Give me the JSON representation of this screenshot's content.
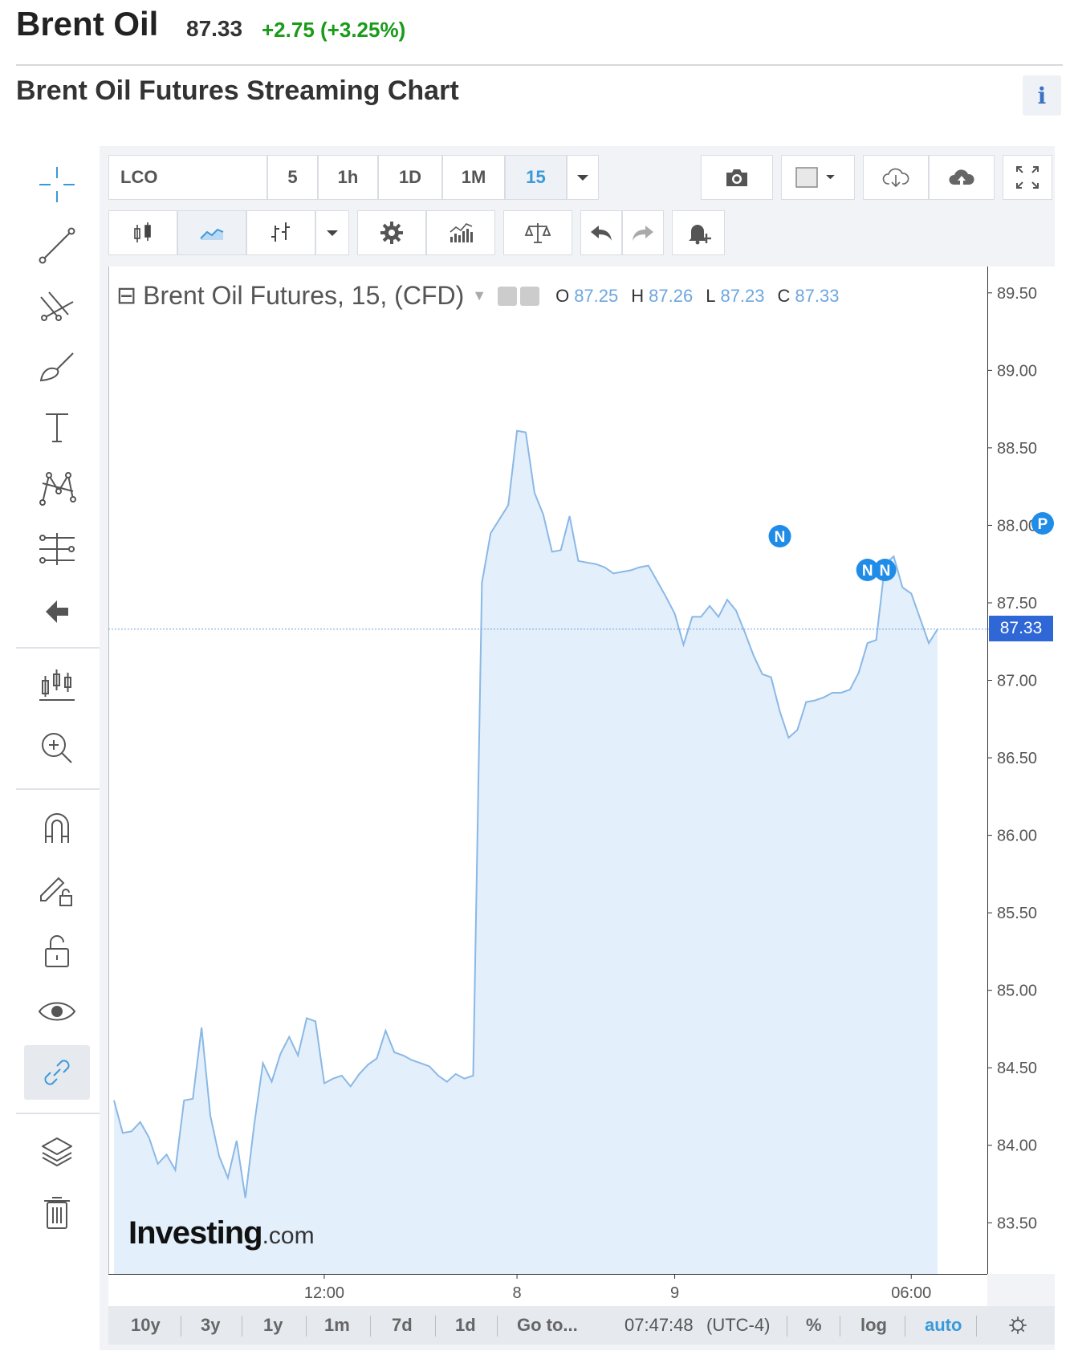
{
  "header": {
    "title": "Brent Oil",
    "price": "87.33",
    "change": "+2.75 (+3.25%)"
  },
  "chart_heading": "Brent Oil Futures Streaming Chart",
  "info_label": "i",
  "toolbar": {
    "symbol": "LCO",
    "intervals": [
      "5",
      "1h",
      "1D",
      "1M",
      "15"
    ],
    "selected_interval": "15"
  },
  "legend": {
    "collapse": "⊟",
    "title": "Brent Oil Futures, 15, (CFD)",
    "o_label": "O",
    "o_value": "87.25",
    "h_label": "H",
    "h_value": "87.26",
    "l_label": "L",
    "l_value": "87.23",
    "c_label": "C",
    "c_value": "87.33"
  },
  "watermark": {
    "brand": "Investing",
    "suffix": ".com"
  },
  "price_tag": "87.33",
  "bottom_bar": {
    "ranges": [
      "10y",
      "3y",
      "1y",
      "1m",
      "7d",
      "1d"
    ],
    "goto": "Go to...",
    "clock": "07:47:48",
    "timezone": "(UTC-4)",
    "percent": "%",
    "log": "log",
    "auto": "auto"
  },
  "event_markers": [
    {
      "label": "N",
      "x_index": 76
    },
    {
      "label": "N",
      "x_index": 86
    },
    {
      "label": "N",
      "x_index": 88
    },
    {
      "label": "P",
      "x_index": 106
    }
  ],
  "colors": {
    "line": "#8ab8e6",
    "area": "#e3effb",
    "price_tag": "#2f67d7",
    "marker": "#1f8ce8",
    "positive": "#1a9b1a"
  },
  "chart_data": {
    "type": "area",
    "title": "Brent Oil Futures, 15, (CFD)",
    "y_ticks": [
      "89.50",
      "89.00",
      "88.50",
      "88.00",
      "87.50",
      "87.00",
      "86.50",
      "86.00",
      "85.50",
      "85.00",
      "84.50",
      "84.00",
      "83.50"
    ],
    "ylim": [
      83.17,
      89.67
    ],
    "x_ticks": [
      {
        "label": "12:00",
        "index": 24
      },
      {
        "label": "8",
        "index": 46
      },
      {
        "label": "9",
        "index": 64
      },
      {
        "label": "06:00",
        "index": 91
      }
    ],
    "x_count": 110,
    "last_value": 87.33,
    "values": [
      84.29,
      84.08,
      84.09,
      84.15,
      84.05,
      83.88,
      83.94,
      83.84,
      84.29,
      84.3,
      84.76,
      84.19,
      83.93,
      83.79,
      84.03,
      83.66,
      84.13,
      84.53,
      84.41,
      84.59,
      84.7,
      84.58,
      84.82,
      84.8,
      84.4,
      84.43,
      84.45,
      84.38,
      84.46,
      84.52,
      84.56,
      84.74,
      84.6,
      84.58,
      84.55,
      84.53,
      84.51,
      84.45,
      84.41,
      84.46,
      84.43,
      84.45,
      87.63,
      87.95,
      88.04,
      88.13,
      88.61,
      88.6,
      88.21,
      88.07,
      87.83,
      87.84,
      88.06,
      87.77,
      87.76,
      87.75,
      87.73,
      87.69,
      87.7,
      87.71,
      87.73,
      87.74,
      87.64,
      87.54,
      87.43,
      87.23,
      87.41,
      87.41,
      87.48,
      87.41,
      87.52,
      87.45,
      87.31,
      87.16,
      87.04,
      87.02,
      86.8,
      86.63,
      86.68,
      86.86,
      86.87,
      86.89,
      86.92,
      86.92,
      86.94,
      87.05,
      87.24,
      87.26,
      87.75,
      87.8,
      87.6,
      87.56,
      87.4,
      87.24,
      87.33
    ]
  }
}
